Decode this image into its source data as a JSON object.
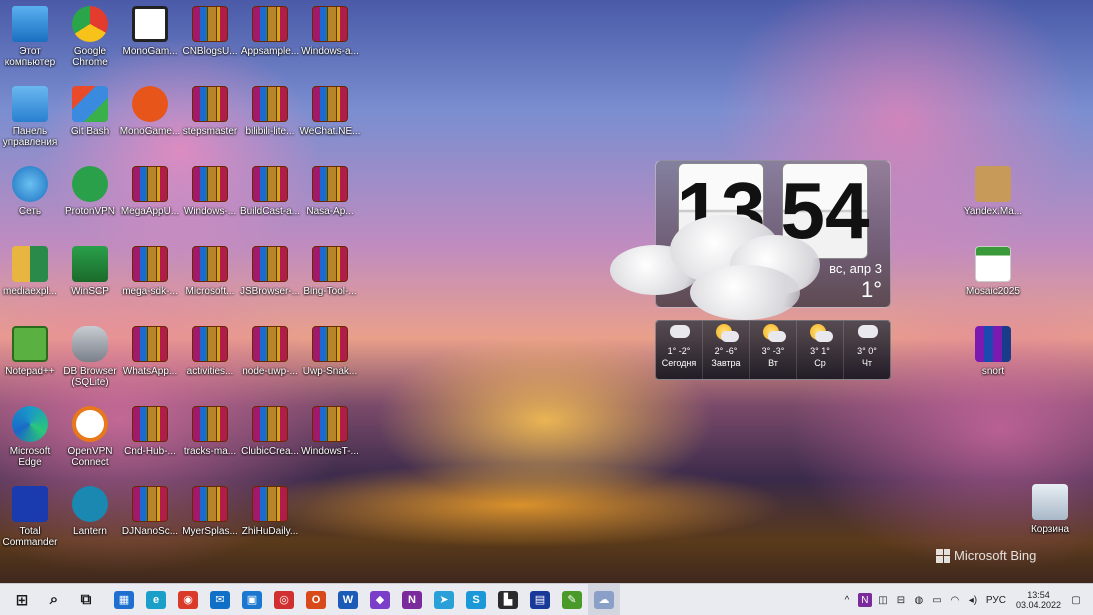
{
  "desktop_icons": [
    {
      "label": "Этот\nкомпьютер",
      "kind": "computer",
      "col": 0,
      "row": 0
    },
    {
      "label": "Google\nChrome",
      "kind": "chrome",
      "col": 1,
      "row": 0
    },
    {
      "label": "MonoGam...",
      "kind": "mono",
      "col": 2,
      "row": 0
    },
    {
      "label": "CNBlogsU...",
      "kind": "rar",
      "col": 3,
      "row": 0
    },
    {
      "label": "Appsample...",
      "kind": "rar",
      "col": 4,
      "row": 0
    },
    {
      "label": "Windows-a...",
      "kind": "rar",
      "col": 5,
      "row": 0
    },
    {
      "label": "Панель\nуправления",
      "kind": "panel",
      "col": 0,
      "row": 1
    },
    {
      "label": "Git Bash",
      "kind": "gitbash",
      "col": 1,
      "row": 1
    },
    {
      "label": "MonoGame...",
      "kind": "monogame",
      "col": 2,
      "row": 1
    },
    {
      "label": "stepsmaster",
      "kind": "rar",
      "col": 3,
      "row": 1
    },
    {
      "label": "bilibili-lite...",
      "kind": "rar",
      "col": 4,
      "row": 1
    },
    {
      "label": "WeChat.NE...",
      "kind": "rar",
      "col": 5,
      "row": 1
    },
    {
      "label": "Сеть",
      "kind": "network",
      "col": 0,
      "row": 2
    },
    {
      "label": "ProtonVPN",
      "kind": "proton",
      "col": 1,
      "row": 2
    },
    {
      "label": "MegaAppU...",
      "kind": "rar",
      "col": 2,
      "row": 2
    },
    {
      "label": "Windows-...",
      "kind": "rar",
      "col": 3,
      "row": 2
    },
    {
      "label": "BuildCast-a...",
      "kind": "rar",
      "col": 4,
      "row": 2
    },
    {
      "label": "Nasa-Ap...",
      "kind": "rar",
      "col": 5,
      "row": 2
    },
    {
      "label": "mediaexpl...",
      "kind": "user",
      "col": 0,
      "row": 3
    },
    {
      "label": "WinSCP",
      "kind": "winscp",
      "col": 1,
      "row": 3
    },
    {
      "label": "mega-sdk-...",
      "kind": "rar",
      "col": 2,
      "row": 3
    },
    {
      "label": "Microsoft...",
      "kind": "rar",
      "col": 3,
      "row": 3
    },
    {
      "label": "JSBrowser-...",
      "kind": "rar",
      "col": 4,
      "row": 3
    },
    {
      "label": "Bing-Tool-...",
      "kind": "rar",
      "col": 5,
      "row": 3
    },
    {
      "label": "Notepad++",
      "kind": "notepad",
      "col": 0,
      "row": 4
    },
    {
      "label": "DB Browser\n(SQLite)",
      "kind": "db",
      "col": 1,
      "row": 4
    },
    {
      "label": "WhatsApp...",
      "kind": "rar",
      "col": 2,
      "row": 4
    },
    {
      "label": "activities...",
      "kind": "rar",
      "col": 3,
      "row": 4
    },
    {
      "label": "node-uwp-...",
      "kind": "rar",
      "col": 4,
      "row": 4
    },
    {
      "label": "Uwp-Snak...",
      "kind": "rar",
      "col": 5,
      "row": 4
    },
    {
      "label": "Microsoft\nEdge",
      "kind": "edge",
      "col": 0,
      "row": 5
    },
    {
      "label": "OpenVPN\nConnect",
      "kind": "openvpn",
      "col": 1,
      "row": 5
    },
    {
      "label": "Cnd-Hub-...",
      "kind": "rar",
      "col": 2,
      "row": 5
    },
    {
      "label": "tracks-ma...",
      "kind": "rar",
      "col": 3,
      "row": 5
    },
    {
      "label": "ClubicCrea...",
      "kind": "rar",
      "col": 4,
      "row": 5
    },
    {
      "label": "WindowsT-...",
      "kind": "rar",
      "col": 5,
      "row": 5
    },
    {
      "label": "Total\nCommander",
      "kind": "total",
      "col": 0,
      "row": 6
    },
    {
      "label": "Lantern",
      "kind": "lantern",
      "col": 1,
      "row": 6
    },
    {
      "label": "DJNanoSc...",
      "kind": "rar",
      "col": 2,
      "row": 6
    },
    {
      "label": "MyerSplas...",
      "kind": "rar",
      "col": 3,
      "row": 6
    },
    {
      "label": "ZhiHuDaily...",
      "kind": "rar",
      "col": 4,
      "row": 6
    }
  ],
  "right_icons": [
    {
      "label": "Yandex.Ma...",
      "kind": "box"
    },
    {
      "label": "Mosaic2025",
      "kind": "mosaic"
    },
    {
      "label": "snort",
      "kind": "snort"
    },
    {
      "label": "Корзина",
      "kind": "bin"
    }
  ],
  "clock": {
    "hours": "13",
    "minutes": "54",
    "date": "вс, апр 3",
    "temp": "1°"
  },
  "forecast": [
    {
      "day": "Сегодня",
      "temp": "1° -2°",
      "icon": "snow-cloud-icon"
    },
    {
      "day": "Завтра",
      "temp": "2° -6°",
      "icon": "sun-cloud-icon"
    },
    {
      "day": "Вт",
      "temp": "3° -3°",
      "icon": "sun-cloud-icon"
    },
    {
      "day": "Ср",
      "temp": "3° 1°",
      "icon": "sun-cloud-icon"
    },
    {
      "day": "Чт",
      "temp": "3° 0°",
      "icon": "snow-cloud-icon"
    }
  ],
  "watermark": "Microsoft Bing",
  "taskbar": {
    "apps": [
      {
        "name": "start-icon",
        "color": "#1b1b1b",
        "glyph": "⊞"
      },
      {
        "name": "search-icon",
        "color": "#1b1b1b",
        "glyph": "⌕"
      },
      {
        "name": "task-view-icon",
        "color": "#1b1b1b",
        "glyph": "⧉"
      },
      {
        "name": "store-icon",
        "color": "#1f6fd0",
        "glyph": "▦"
      },
      {
        "name": "edge-icon",
        "color": "#1aa0c8",
        "glyph": "e"
      },
      {
        "name": "chrome-icon",
        "color": "#d93a2a",
        "glyph": "◉"
      },
      {
        "name": "mail-icon",
        "color": "#1070c8",
        "glyph": "✉"
      },
      {
        "name": "remote-desktop-icon",
        "color": "#1a78d0",
        "glyph": "▣"
      },
      {
        "name": "media-player-icon",
        "color": "#d03030",
        "glyph": "◎"
      },
      {
        "name": "office-icon",
        "color": "#d84a1a",
        "glyph": "O"
      },
      {
        "name": "word-icon",
        "color": "#1b5bb8",
        "glyph": "W"
      },
      {
        "name": "visual-studio-icon",
        "color": "#7a3ec8",
        "glyph": "◆"
      },
      {
        "name": "onenote-icon",
        "color": "#7a2a9a",
        "glyph": "N"
      },
      {
        "name": "telegram-icon",
        "color": "#2aa0d8",
        "glyph": "➤"
      },
      {
        "name": "skype-icon",
        "color": "#1a98d8",
        "glyph": "S"
      },
      {
        "name": "sticky-notes-icon",
        "color": "#2b2b2b",
        "glyph": "▙"
      },
      {
        "name": "floppy-save-icon",
        "color": "#1a3a9a",
        "glyph": "▤"
      },
      {
        "name": "notepadpp-icon",
        "color": "#4a9a2a",
        "glyph": "✎"
      },
      {
        "name": "weather-icon",
        "color": "#8aa0c8",
        "glyph": "☁"
      }
    ],
    "tray": {
      "lang": "РУС",
      "time": "13:54",
      "date": "03.04.2022"
    }
  }
}
